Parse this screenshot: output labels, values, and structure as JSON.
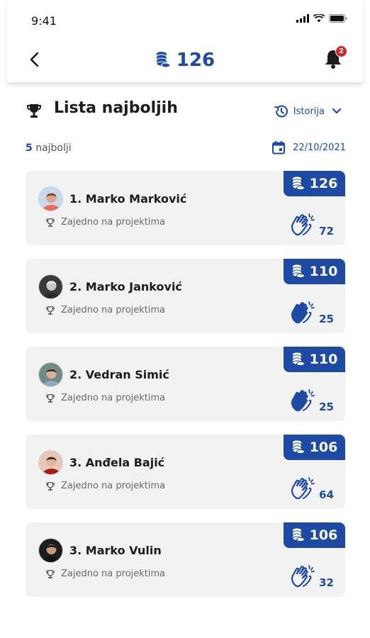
{
  "status": {
    "time": "9:41"
  },
  "nav": {
    "coins": "126",
    "notifications": "2"
  },
  "page": {
    "title": "Lista najboljih",
    "history_label": "Istorija"
  },
  "summary": {
    "count": "5",
    "count_label": "najbolji",
    "date": "22/10/2021"
  },
  "players": [
    {
      "name": "1. Marko Marković",
      "sub": "Zajedno na projektima",
      "coins": "126",
      "claps": "72",
      "clap_style": "outline",
      "avatar": {
        "bg": "#c9d8ea",
        "shirt": "#e8685a",
        "skin": "#d9a48a",
        "hair": "#6b4a36"
      }
    },
    {
      "name": "2. Marko Janković",
      "sub": "Zajedno na projektima",
      "coins": "110",
      "claps": "25",
      "clap_style": "filled",
      "avatar": {
        "bg": "#3a3a3a",
        "shirt": "#2a2a2a",
        "skin": "#c9c9c9",
        "hair": "#e5e5e5"
      }
    },
    {
      "name": "2. Vedran Simić",
      "sub": "Zajedno na projektima",
      "coins": "110",
      "claps": "25",
      "clap_style": "filled",
      "avatar": {
        "bg": "#6f8b86",
        "shirt": "#8fa9c5",
        "skin": "#d8b29b",
        "hair": "#3a2b22"
      }
    },
    {
      "name": "3. Anđela Bajić",
      "sub": "Zajedno na projektima",
      "coins": "106",
      "claps": "64",
      "clap_style": "outline",
      "avatar": {
        "bg": "#e8c7b8",
        "shirt": "#a51c1c",
        "skin": "#e0b59e",
        "hair": "#3b2418"
      }
    },
    {
      "name": "3. Marko Vulin",
      "sub": "Zajedno na projektima",
      "coins": "106",
      "claps": "32",
      "clap_style": "outline",
      "avatar": {
        "bg": "#1e1e1e",
        "shirt": "#141414",
        "skin": "#c89a80",
        "hair": "#181818"
      }
    }
  ],
  "colors": {
    "accent": "#1d4aa4",
    "badge": "#d8232a",
    "card": "#f2f2f2"
  },
  "icons": [
    "back-arrow-icon",
    "coins-icon",
    "bell-icon",
    "trophy-icon",
    "history-icon",
    "chevron-down-icon",
    "calendar-icon",
    "clap-icon"
  ]
}
